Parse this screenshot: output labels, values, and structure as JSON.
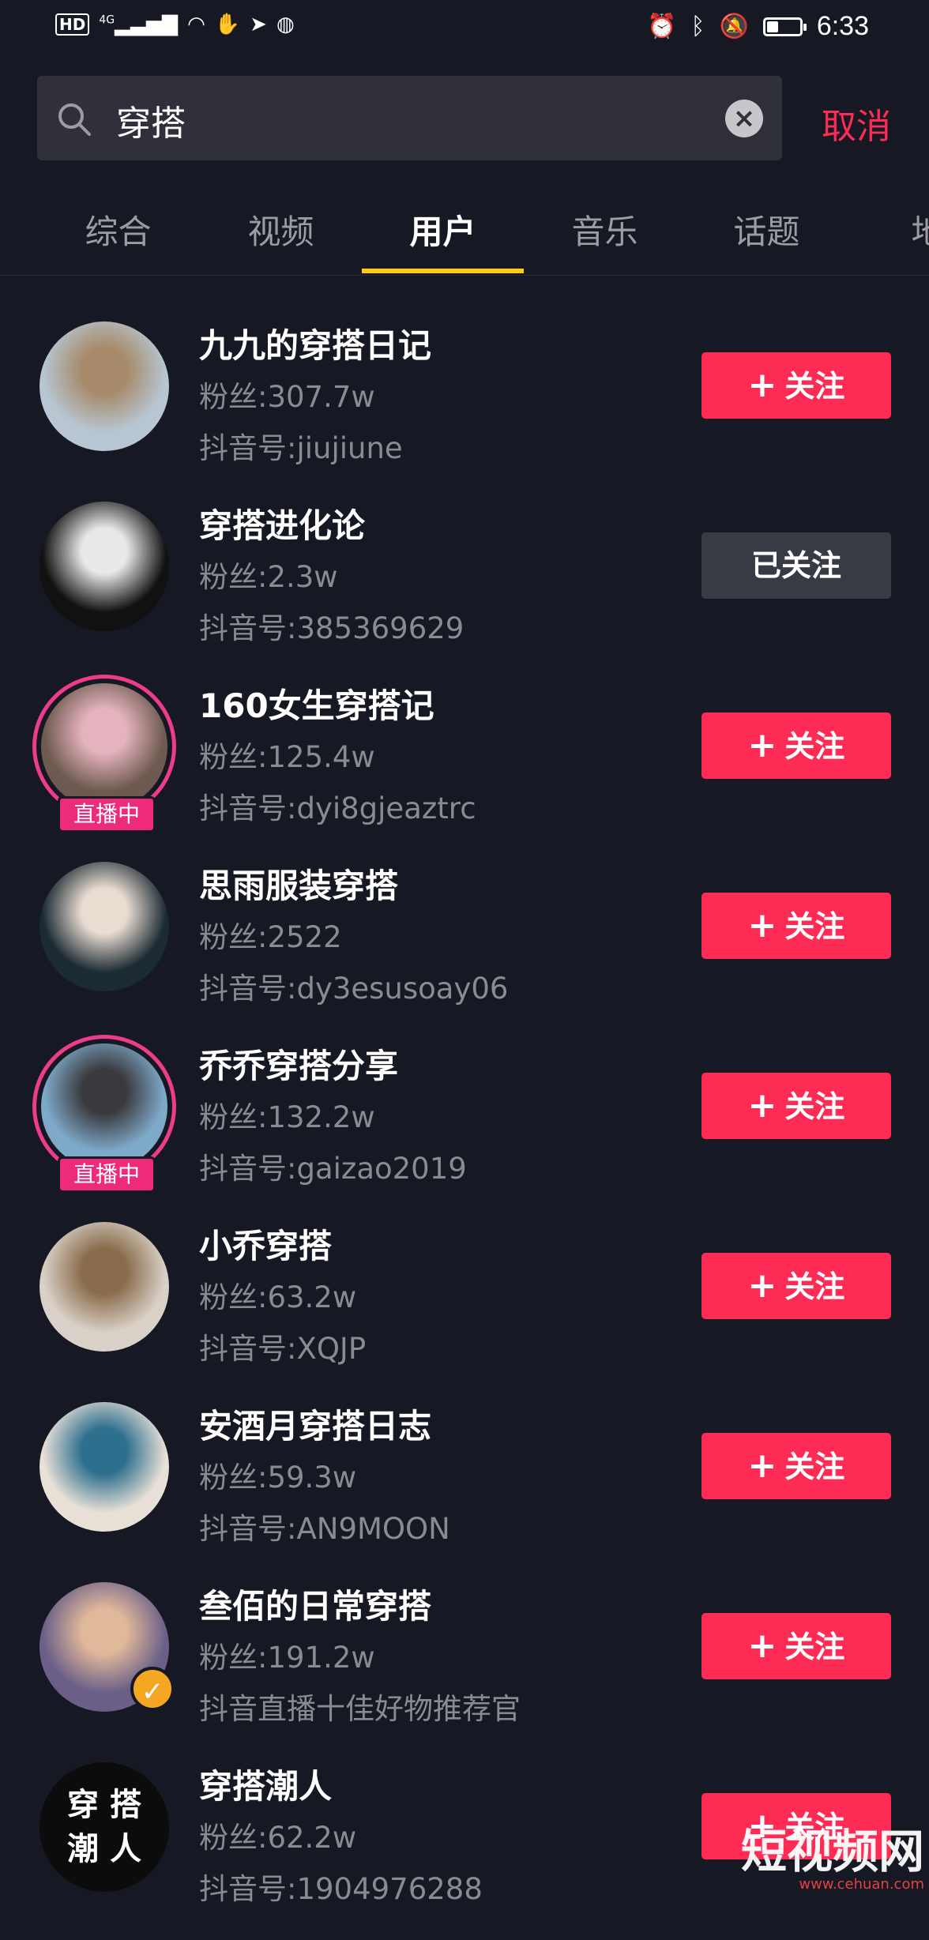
{
  "status_bar": {
    "hd": "HD",
    "network": "4G",
    "time": "6:33",
    "battery_level": 0.35
  },
  "search": {
    "query": "穿搭",
    "cancel_label": "取消"
  },
  "tabs": [
    {
      "label": "综合",
      "active": false
    },
    {
      "label": "视频",
      "active": false
    },
    {
      "label": "用户",
      "active": true
    },
    {
      "label": "音乐",
      "active": false
    },
    {
      "label": "话题",
      "active": false
    },
    {
      "label": "地",
      "active": false
    }
  ],
  "users": [
    {
      "name": "九九的穿搭日记",
      "fans": "粉丝:307.7w",
      "sub": "抖音号:jiujiune",
      "button": "关注",
      "followed": false,
      "live": false,
      "verified": false,
      "avatar_colors": [
        "#b7c6d2",
        "#a68a69"
      ]
    },
    {
      "name": "穿搭进化论",
      "fans": "粉丝:2.3w",
      "sub": "抖音号:385369629",
      "button": "已关注",
      "followed": true,
      "live": false,
      "verified": false,
      "avatar_colors": [
        "#111111",
        "#e8e8e8"
      ]
    },
    {
      "name": "160女生穿搭记",
      "fans": "粉丝:125.4w",
      "sub": "抖音号:dyi8gjeaztrc",
      "button": "关注",
      "followed": false,
      "live": true,
      "live_label": "直播中",
      "verified": false,
      "avatar_colors": [
        "#6e5a50",
        "#e4b3bd"
      ]
    },
    {
      "name": "思雨服装穿搭",
      "fans": "粉丝:2522",
      "sub": "抖音号:dy3esusoay06",
      "button": "关注",
      "followed": false,
      "live": false,
      "verified": false,
      "avatar_colors": [
        "#1c2a33",
        "#e9ddd2"
      ]
    },
    {
      "name": "乔乔穿搭分享",
      "fans": "粉丝:132.2w",
      "sub": "抖音号:gaizao2019",
      "button": "关注",
      "followed": false,
      "live": true,
      "live_label": "直播中",
      "verified": false,
      "avatar_colors": [
        "#7fa9c9",
        "#3a3a3e"
      ]
    },
    {
      "name": "小乔穿搭",
      "fans": "粉丝:63.2w",
      "sub": "抖音号:XQJP",
      "button": "关注",
      "followed": false,
      "live": false,
      "verified": false,
      "avatar_colors": [
        "#d9d1c7",
        "#8a6c4c"
      ]
    },
    {
      "name": "安酒月穿搭日志",
      "fans": "粉丝:59.3w",
      "sub": "抖音号:AN9MOON",
      "button": "关注",
      "followed": false,
      "live": false,
      "verified": false,
      "avatar_colors": [
        "#e9e1d7",
        "#2e6f8e"
      ]
    },
    {
      "name": "叁佰的日常穿搭",
      "fans": "粉丝:191.2w",
      "sub": "抖音直播十佳好物推荐官",
      "button": "关注",
      "followed": false,
      "live": false,
      "verified": true,
      "avatar_colors": [
        "#6b5f88",
        "#e0b89a"
      ]
    },
    {
      "name": "穿搭潮人",
      "fans": "粉丝:62.2w",
      "sub": "抖音号:1904976288",
      "button": "关注",
      "followed": false,
      "live": false,
      "verified": false,
      "avatar_text": "穿 搭 潮 人",
      "avatar_colors": [
        "#0c0c0c",
        "#ffffff"
      ]
    }
  ],
  "watermark": {
    "text": "短视频网",
    "url": "www.cehuan.com"
  }
}
